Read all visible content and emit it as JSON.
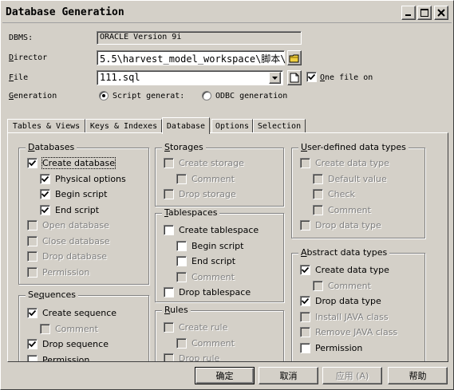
{
  "window": {
    "title": "Database Generation"
  },
  "form": {
    "dbms_label": "DBMS:",
    "dbms_value": "ORACLE Version 9i",
    "director_label": "Director",
    "director_value": "5.5\\harvest_model_workspace\\脚本\\",
    "file_label": "File",
    "file_value": "111.sql",
    "one_file_label": "One file on",
    "generation_label": "Generation",
    "script_option": "Script generat:",
    "odbc_option": "ODBC generation"
  },
  "tabs": [
    {
      "label": "Tables & Views"
    },
    {
      "label": "Keys & Indexes"
    },
    {
      "label": "Database"
    },
    {
      "label": "Options"
    },
    {
      "label": "Selection"
    }
  ],
  "groups": {
    "databases": {
      "title": "Databases",
      "items": [
        "Create database",
        "Physical options",
        "Begin script",
        "End script",
        "Open database",
        "Close database",
        "Drop database",
        "Permission"
      ]
    },
    "sequences": {
      "title": "Sequences",
      "items": [
        "Create sequence",
        "Comment",
        "Drop sequence",
        "Permission"
      ]
    },
    "storages": {
      "title": "Storages",
      "items": [
        "Create storage",
        "Comment",
        "Drop storage"
      ]
    },
    "tablespaces": {
      "title": "Tablespaces",
      "items": [
        "Create tablespace",
        "Begin script",
        "End script",
        "Comment",
        "Drop tablespace"
      ]
    },
    "rules": {
      "title": "Rules",
      "items": [
        "Create rule",
        "Comment",
        "Drop rule"
      ]
    },
    "udt": {
      "title": "User-defined data types",
      "items": [
        "Create data type",
        "Default value",
        "Check",
        "Comment",
        "Drop data type"
      ]
    },
    "adt": {
      "title": "Abstract data types",
      "items": [
        "Create data type",
        "Comment",
        "Drop data type",
        "Install JAVA class",
        "Remove JAVA class",
        "Permission"
      ]
    }
  },
  "buttons": {
    "ok": "确定",
    "cancel": "取消",
    "apply": "应用 (A)",
    "help": "帮助"
  }
}
